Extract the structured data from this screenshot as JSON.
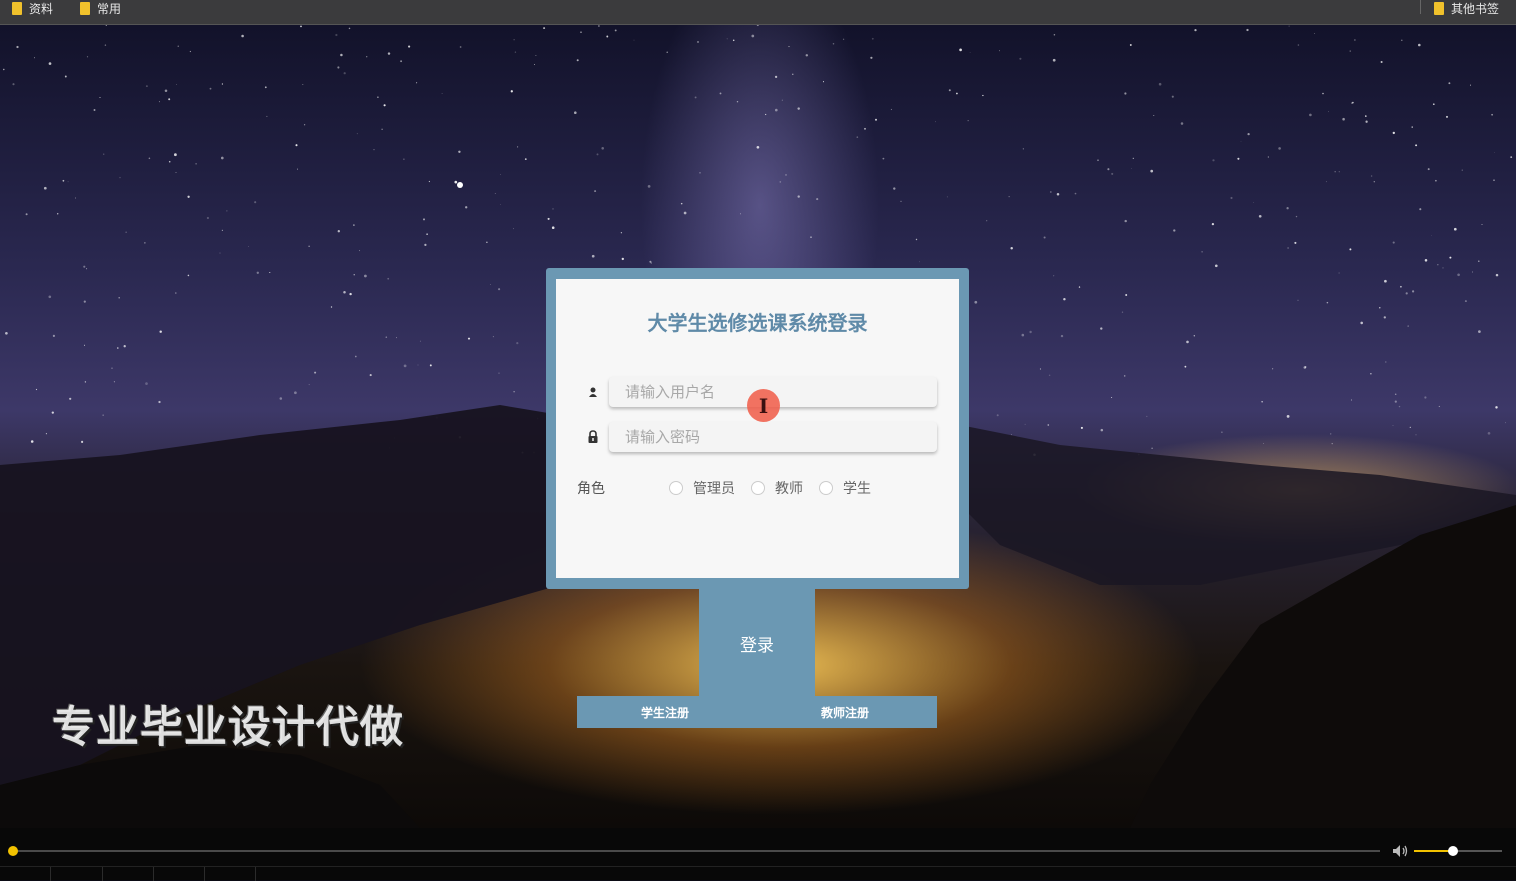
{
  "bookmarks": {
    "items": [
      {
        "label": "资料"
      },
      {
        "label": "常用"
      }
    ],
    "other_label": "其他书签"
  },
  "watermark": "专业毕业设计代做",
  "login": {
    "title": "大学生选修选课系统登录",
    "username_placeholder": "请输入用户名",
    "password_placeholder": "请输入密码",
    "role_label": "角色",
    "roles": [
      "管理员",
      "教师",
      "学生"
    ],
    "login_button": "登录",
    "student_register": "学生注册",
    "teacher_register": "教师注册"
  },
  "colors": {
    "accent": "#6b98b3",
    "title": "#5f8aa8",
    "progress": "#f2c200"
  },
  "player": {
    "progress": 0.0,
    "volume": 0.45
  }
}
